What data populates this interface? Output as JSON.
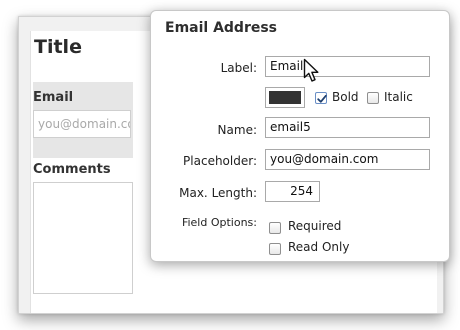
{
  "form": {
    "title": "Title",
    "email_label": "Email",
    "email_placeholder": "you@domain.com",
    "comments_label": "Comments"
  },
  "popover": {
    "title": "Email Address",
    "label_caption": "Label:",
    "label_value": "Email",
    "color_swatch": "#333333",
    "bold_label": "Bold",
    "bold_checked": true,
    "italic_label": "Italic",
    "italic_checked": false,
    "name_caption": "Name:",
    "name_value": "email5",
    "placeholder_caption": "Placeholder:",
    "placeholder_value": "you@domain.com",
    "maxlength_caption": "Max. Length:",
    "maxlength_value": "254",
    "field_options_caption": "Field Options:",
    "required_label": "Required",
    "required_checked": false,
    "readonly_label": "Read Only",
    "readonly_checked": false
  },
  "cursor_icon": "arrow-cursor-icon"
}
